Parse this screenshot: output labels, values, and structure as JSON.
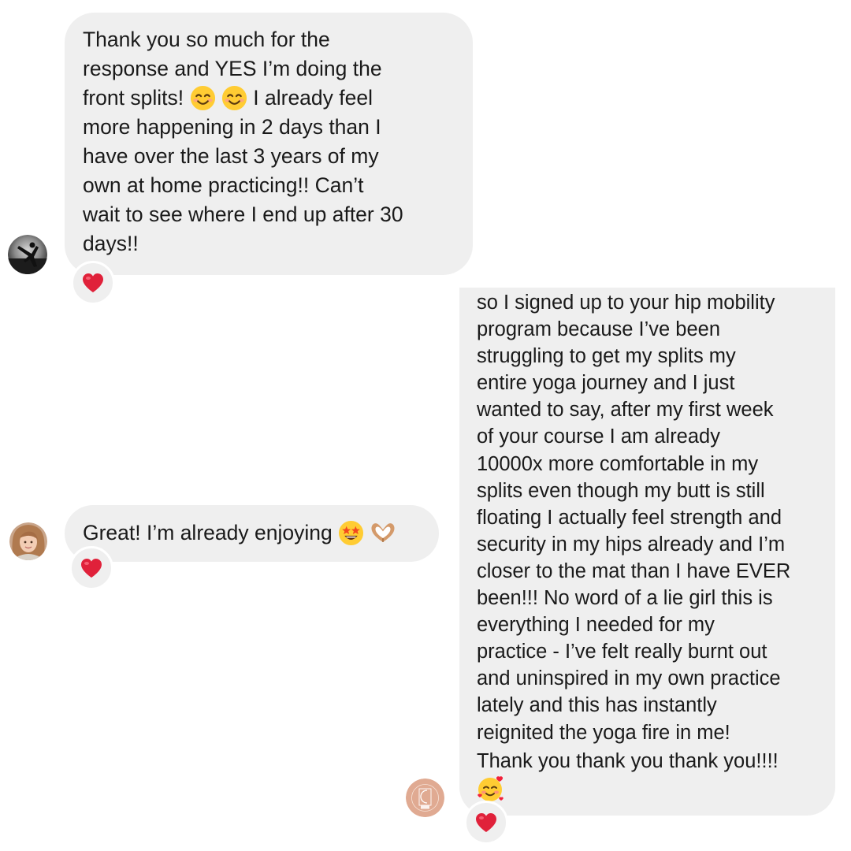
{
  "thread": {
    "messages": [
      {
        "sender": "other",
        "lines": [
          "Thank you so much for the",
          "response and YES I’m doing the",
          "front splits!",
          "I already feel",
          "more happening in 2 days than I",
          "have over the last 3 years of my",
          "own at home practicing!! Can’t",
          "wait to see where I end up after 30",
          "days!!"
        ],
        "emojis": [
          "smiling-face-with-smiling-eyes",
          "smiling-face-with-smiling-eyes"
        ],
        "reaction": "red-heart"
      },
      {
        "sender": "other",
        "lines": [
          "Great! I’m already enjoying"
        ],
        "emojis": [
          "star-struck-face",
          "heart-hands"
        ],
        "reaction": "red-heart"
      },
      {
        "sender": "other",
        "lines": [
          "so I signed up to your hip mobility",
          "program because I’ve been",
          "struggling to get my splits my",
          "entire yoga journey and I just",
          "wanted to say, after my first week",
          "of your course I am already",
          "10000x more comfortable in my",
          "splits even though my butt is still",
          "floating I actually feel strength and",
          "security in my hips already and I’m",
          "closer to the mat than I have EVER",
          "been!!! No word of a lie girl this is",
          "everything I needed for my",
          "practice - I’ve felt really burnt out",
          "and uninspired in my own practice",
          "lately and this has instantly",
          "reignited the yoga fire in me!",
          "Thank you thank you thank you!!!!"
        ],
        "emojis": [
          "smiling-face-with-hearts"
        ],
        "reaction": "red-heart"
      }
    ]
  },
  "colors": {
    "bubble": "#efefef",
    "background": "#ffffff",
    "text": "#1a1a1a",
    "heart": "#e0213a"
  }
}
